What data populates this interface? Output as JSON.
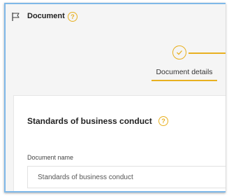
{
  "header": {
    "title": "Document",
    "help_icon": "question-circle-icon",
    "flag_icon": "flag-icon"
  },
  "stepper": {
    "steps": [
      {
        "label": "Document details",
        "state": "completed"
      }
    ],
    "accent_color": "#e8b020"
  },
  "card": {
    "title": "Standards of business conduct",
    "help_icon": "question-circle-icon",
    "fields": [
      {
        "label": "Document name",
        "value": "Standards of business conduct"
      }
    ]
  },
  "colors": {
    "accent": "#e8b020",
    "frame_border": "#7fb8e8",
    "background": "#f5f5f5"
  }
}
